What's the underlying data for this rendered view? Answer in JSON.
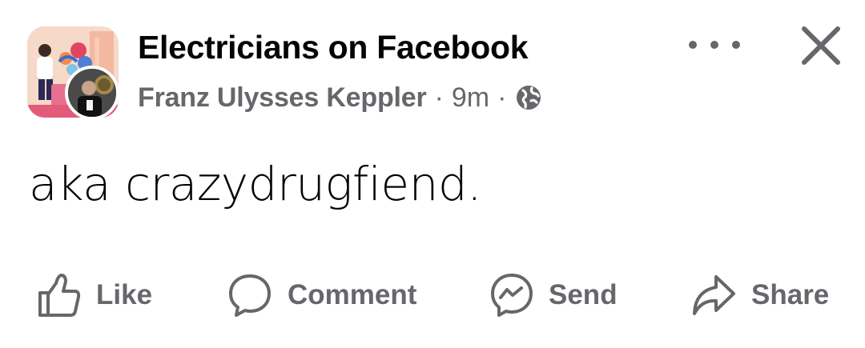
{
  "post": {
    "group_name": "Electricians on Facebook",
    "author": "Franz Ulysses Keppler",
    "separator": "·",
    "time": "9m",
    "privacy_icon": "globe-icon",
    "text": "aka crazydrugfiend."
  },
  "header_actions": {
    "more_icon": "more-horizontal-icon",
    "close_icon": "close-icon"
  },
  "actions": [
    {
      "label": "Like",
      "icon": "thumbs-up-icon"
    },
    {
      "label": "Comment",
      "icon": "comment-icon"
    },
    {
      "label": "Send",
      "icon": "messenger-icon"
    },
    {
      "label": "Share",
      "icon": "share-icon"
    }
  ],
  "colors": {
    "text_primary": "#050505",
    "text_secondary": "#65676b",
    "background": "#ffffff"
  }
}
